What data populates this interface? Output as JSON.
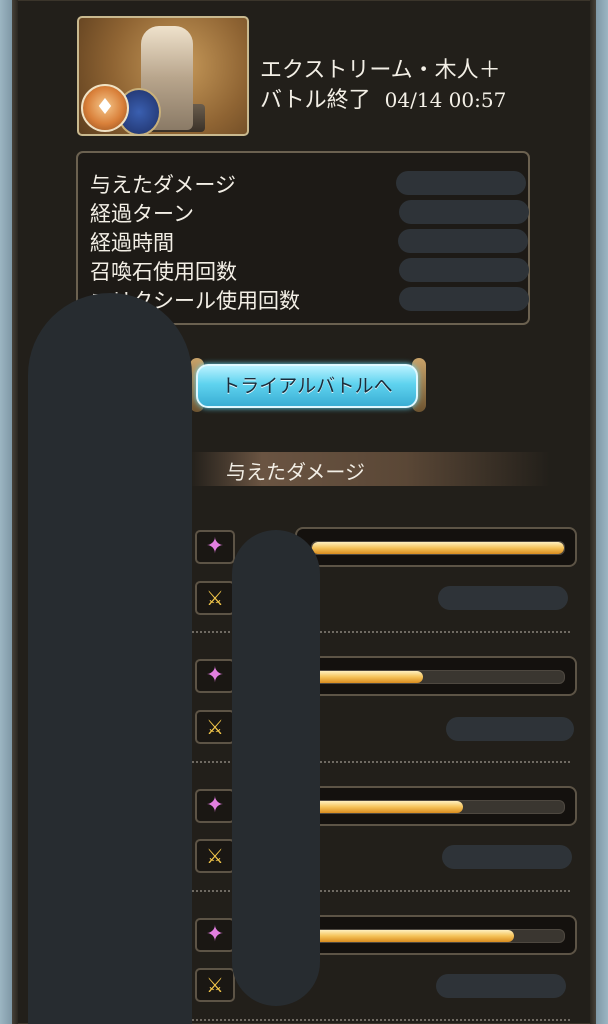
{
  "quest": {
    "name": "エクストリーム・木人＋",
    "result": "バトル終了",
    "timestamp": "04/14 00:57",
    "element_glyph": "♦"
  },
  "stats": {
    "labels": [
      "与えたダメージ",
      "経過ターン",
      "経過時間",
      "召喚石使用回数",
      "エリクシール使用回数"
    ]
  },
  "trial_button": {
    "label": "トライアルバトルへ"
  },
  "damage_section": {
    "title": "与えたダメージ"
  },
  "damage_rows": [
    {
      "star_icon": "✦",
      "swords_icon": "⚔",
      "bar_fraction": 1.0
    },
    {
      "star_icon": "✦",
      "swords_icon": "⚔",
      "bar_fraction": 0.44
    },
    {
      "star_icon": "✦",
      "swords_icon": "⚔",
      "bar_fraction": 0.6
    },
    {
      "star_icon": "✦",
      "swords_icon": "⚔",
      "bar_fraction": 0.8
    }
  ],
  "colors": {
    "panel_bg": "#221f1a",
    "bar_fill": "#f5c35a",
    "button_cyan": "#5fd3ef",
    "star_pink": "#e27fe0",
    "swords_gold": "#f2c64a"
  }
}
